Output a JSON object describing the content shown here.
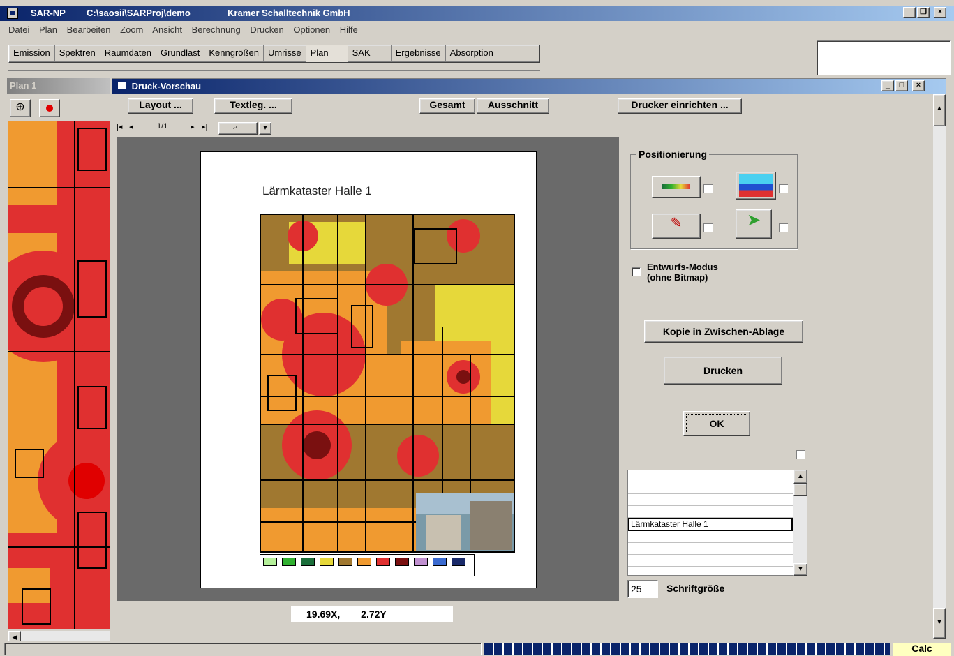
{
  "app": {
    "name": "SAR-NP",
    "path": "C:\\saosii\\SARProj\\demo",
    "company": "Kramer Schalltechnik GmbH"
  },
  "menu": [
    "Datei",
    "Plan",
    "Bearbeiten",
    "Zoom",
    "Ansicht",
    "Berechnung",
    "Drucken",
    "Optionen",
    "Hilfe"
  ],
  "tabs": [
    "Emission",
    "Spektren",
    "Raumdaten",
    "Grundlast",
    "Kenngrößen",
    "Umrisse",
    "Plan",
    "SAK",
    "Ergebnisse",
    "Absorption"
  ],
  "active_tab": "Plan",
  "plan_window": {
    "title": "Plan 1"
  },
  "preview": {
    "title": "Druck-Vorschau",
    "layout_btn": "Layout ...",
    "textleg_btn": "Textleg. ...",
    "gesamt_btn": "Gesamt",
    "ausschnitt_btn": "Ausschnitt",
    "drucker_btn": "Drucker einrichten ...",
    "page_indicator": "1/1",
    "page_title": "Lärmkataster Halle 1",
    "coords_x": "19.69X,",
    "coords_y": "2.72Y"
  },
  "positionierung": {
    "label": "Positionierung"
  },
  "entwurf": {
    "line1": "Entwurfs-Modus",
    "line2": "(ohne Bitmap)"
  },
  "kopie_btn": "Kopie in Zwischen-Ablage",
  "drucken_btn": "Drucken",
  "ok_btn": "OK",
  "text_list": [
    "",
    "",
    "",
    "",
    "Lärmkataster Halle 1",
    "",
    "",
    "",
    ""
  ],
  "font_size": {
    "value": "25",
    "label": "Schriftgröße"
  },
  "status": {
    "calc": "Calc"
  },
  "legend_colors": [
    "#b5f09a",
    "#30b030",
    "#1a6e3a",
    "#e6d83a",
    "#a07830",
    "#f09a30",
    "#e03030",
    "#7a1010",
    "#c090d0",
    "#3a6ad0",
    "#1a2a6a"
  ]
}
